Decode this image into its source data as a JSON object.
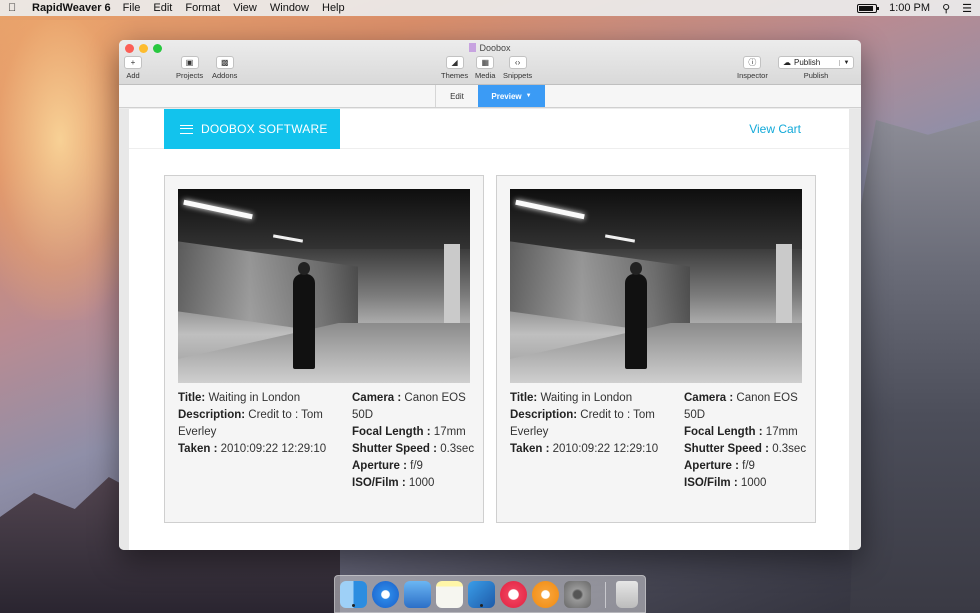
{
  "menubar": {
    "app_name": "RapidWeaver 6",
    "menus": [
      "File",
      "Edit",
      "Format",
      "View",
      "Window",
      "Help"
    ],
    "clock": "1:00 PM"
  },
  "window": {
    "title": "Doobox",
    "toolbar": {
      "add": "Add",
      "projects": "Projects",
      "addons": "Addons",
      "themes": "Themes",
      "media": "Media",
      "snippets": "Snippets",
      "inspector": "Inspector",
      "publish_button": "Publish",
      "publish_label": "Publish"
    },
    "modes": {
      "edit": "Edit",
      "preview": "Preview"
    }
  },
  "site": {
    "brand": "DOOBOX SOFTWARE",
    "cart": "View Cart",
    "cards": [
      {
        "title_label": "Title:",
        "title": "Waiting in London",
        "description_label": "Description:",
        "description": "Credit to : Tom Everley",
        "taken_label": "Taken :",
        "taken": "2010:09:22 12:29:10",
        "camera_label": "Camera :",
        "camera": "Canon EOS 50D",
        "focal_label": "Focal Length :",
        "focal": "17mm",
        "shutter_label": "Shutter Speed :",
        "shutter": "0.3sec",
        "aperture_label": "Aperture :",
        "aperture": "f/9",
        "iso_label": "ISO/Film :",
        "iso": "1000"
      },
      {
        "title_label": "Title:",
        "title": "Waiting in London",
        "description_label": "Description:",
        "description": "Credit to : Tom Everley",
        "taken_label": "Taken :",
        "taken": "2010:09:22 12:29:10",
        "camera_label": "Camera :",
        "camera": "Canon EOS 50D",
        "focal_label": "Focal Length :",
        "focal": "17mm",
        "shutter_label": "Shutter Speed :",
        "shutter": "0.3sec",
        "aperture_label": "Aperture :",
        "aperture": "f/9",
        "iso_label": "ISO/Film :",
        "iso": "1000"
      }
    ]
  },
  "colors": {
    "brand": "#12c3ed",
    "preview_tab": "#3b9bf5",
    "cart_link": "#12a9d9"
  },
  "dock": {
    "icons": [
      "finder-icon",
      "safari-icon",
      "mail-icon",
      "notes-icon",
      "rapidweaver-icon",
      "itunes-icon",
      "ibooks-icon",
      "system-preferences-icon",
      "trash-icon"
    ]
  }
}
